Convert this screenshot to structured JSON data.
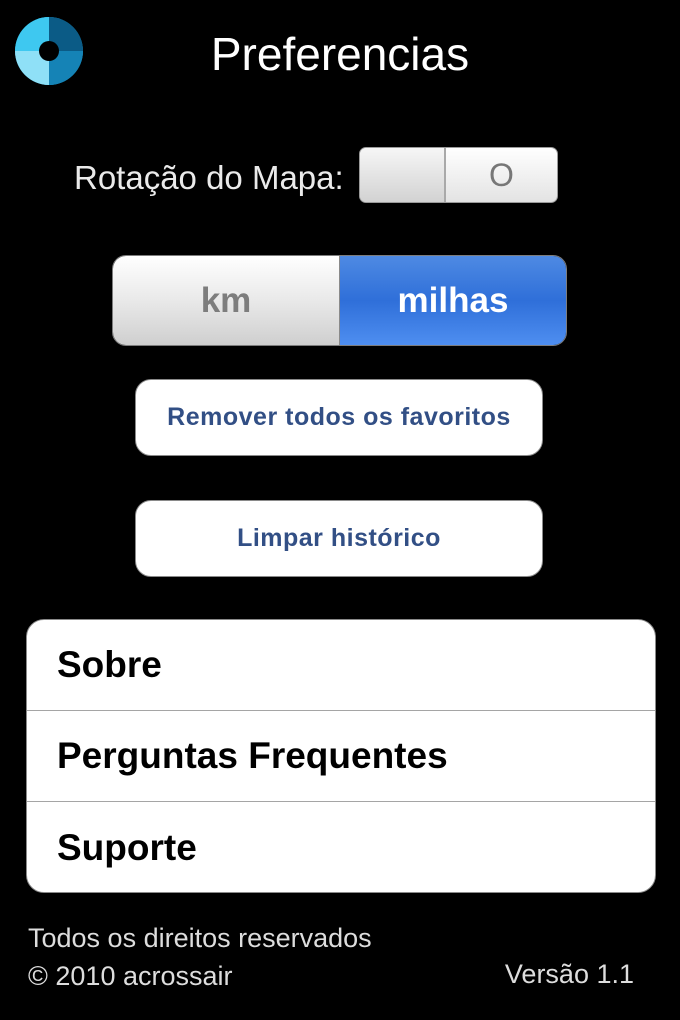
{
  "header": {
    "title": "Preferencias",
    "logo_icon": "aperture-logo-icon"
  },
  "map_rotation": {
    "label": "Rotação do Mapa:",
    "state": "O",
    "enabled": false
  },
  "units": {
    "options": [
      "km",
      "milhas"
    ],
    "selected": "milhas"
  },
  "buttons": {
    "remove_favorites": "Remover todos os favoritos",
    "clear_history": "Limpar histórico"
  },
  "menu": {
    "items": [
      {
        "label": "Sobre"
      },
      {
        "label": "Perguntas Frequentes"
      },
      {
        "label": "Suporte"
      }
    ]
  },
  "footer": {
    "rights": "Todos os direitos reservados",
    "copyright": "© 2010 acrossair",
    "version": "Versão  1.1"
  },
  "colors": {
    "background": "#000000",
    "accent_blue": "#3b78e0",
    "button_text": "#324f85",
    "logo_dark": "#0b5b86",
    "logo_light": "#3ec8f0"
  }
}
